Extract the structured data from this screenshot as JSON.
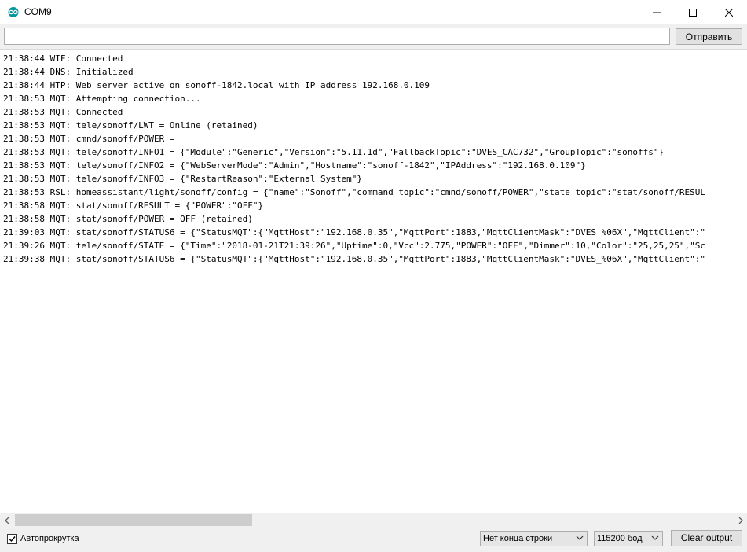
{
  "window": {
    "title": "COM9"
  },
  "toolbar": {
    "input_value": "",
    "send_label": "Отправить"
  },
  "console": {
    "lines": [
      "21:38:44 WIF: Connected",
      "21:38:44 DNS: Initialized",
      "21:38:44 HTP: Web server active on sonoff-1842.local with IP address 192.168.0.109",
      "21:38:53 MQT: Attempting connection...",
      "21:38:53 MQT: Connected",
      "21:38:53 MQT: tele/sonoff/LWT = Online (retained)",
      "21:38:53 MQT: cmnd/sonoff/POWER =",
      "21:38:53 MQT: tele/sonoff/INFO1 = {\"Module\":\"Generic\",\"Version\":\"5.11.1d\",\"FallbackTopic\":\"DVES_CAC732\",\"GroupTopic\":\"sonoffs\"}",
      "21:38:53 MQT: tele/sonoff/INFO2 = {\"WebServerMode\":\"Admin\",\"Hostname\":\"sonoff-1842\",\"IPAddress\":\"192.168.0.109\"}",
      "21:38:53 MQT: tele/sonoff/INFO3 = {\"RestartReason\":\"External System\"}",
      "21:38:53 RSL: homeassistant/light/sonoff/config = {\"name\":\"Sonoff\",\"command_topic\":\"cmnd/sonoff/POWER\",\"state_topic\":\"stat/sonoff/RESUL",
      "21:38:58 MQT: stat/sonoff/RESULT = {\"POWER\":\"OFF\"}",
      "21:38:58 MQT: stat/sonoff/POWER = OFF (retained)",
      "21:39:03 MQT: stat/sonoff/STATUS6 = {\"StatusMQT\":{\"MqttHost\":\"192.168.0.35\",\"MqttPort\":1883,\"MqttClientMask\":\"DVES_%06X\",\"MqttClient\":\"",
      "21:39:26 MQT: tele/sonoff/STATE = {\"Time\":\"2018-01-21T21:39:26\",\"Uptime\":0,\"Vcc\":2.775,\"POWER\":\"OFF\",\"Dimmer\":10,\"Color\":\"25,25,25\",\"Sc",
      "21:39:38 MQT: stat/sonoff/STATUS6 = {\"StatusMQT\":{\"MqttHost\":\"192.168.0.35\",\"MqttPort\":1883,\"MqttClientMask\":\"DVES_%06X\",\"MqttClient\":\""
    ]
  },
  "scroll": {
    "left_arrow": "‹",
    "right_arrow": "›"
  },
  "footer": {
    "autoscroll_label": "Автопрокрутка",
    "autoscroll_checked": true,
    "line_ending_value": "Нет конца строки",
    "baud_value": "115200 бод",
    "clear_label": "Clear output"
  },
  "colors": {
    "arduino_teal": "#00979c",
    "titlebar": "#ffffff",
    "console_bg": "#ffffff"
  },
  "icons": [
    "arduino-logo-icon",
    "minimize-icon",
    "maximize-icon",
    "close-icon",
    "scroll-left-icon",
    "scroll-right-icon",
    "checkmark-icon",
    "chevron-down-icon"
  ]
}
